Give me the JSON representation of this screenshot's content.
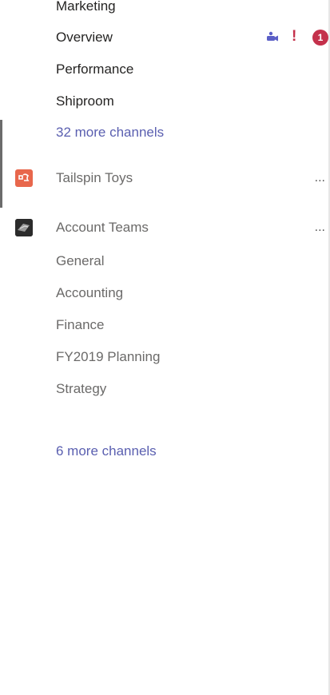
{
  "team1": {
    "channels": [
      {
        "label": "Marketing"
      },
      {
        "label": "Overview",
        "important": "!",
        "mention_count": "1"
      },
      {
        "label": "Performance"
      },
      {
        "label": "Shiproom"
      }
    ],
    "more_channels": "32 more channels"
  },
  "team_tailspin": {
    "name": "Tailspin Toys",
    "more": "..."
  },
  "team_account": {
    "name": "Account Teams",
    "more": "...",
    "channels": [
      {
        "label": "General"
      },
      {
        "label": "Accounting"
      },
      {
        "label": "Finance"
      },
      {
        "label": "FY2019 Planning"
      },
      {
        "label": "Strategy"
      }
    ],
    "more_channels": "6 more channels"
  },
  "colors": {
    "link": "#5a5fb0",
    "important": "#c4314b",
    "tailspin_icon": "#e8674c",
    "account_icon": "#2b2b2b"
  },
  "icons": {
    "overview_status": [
      "meeting-icon",
      "important-icon",
      "mention-badge"
    ],
    "tailspin": "tailspin-team-icon",
    "account": "account-teams-icon"
  }
}
